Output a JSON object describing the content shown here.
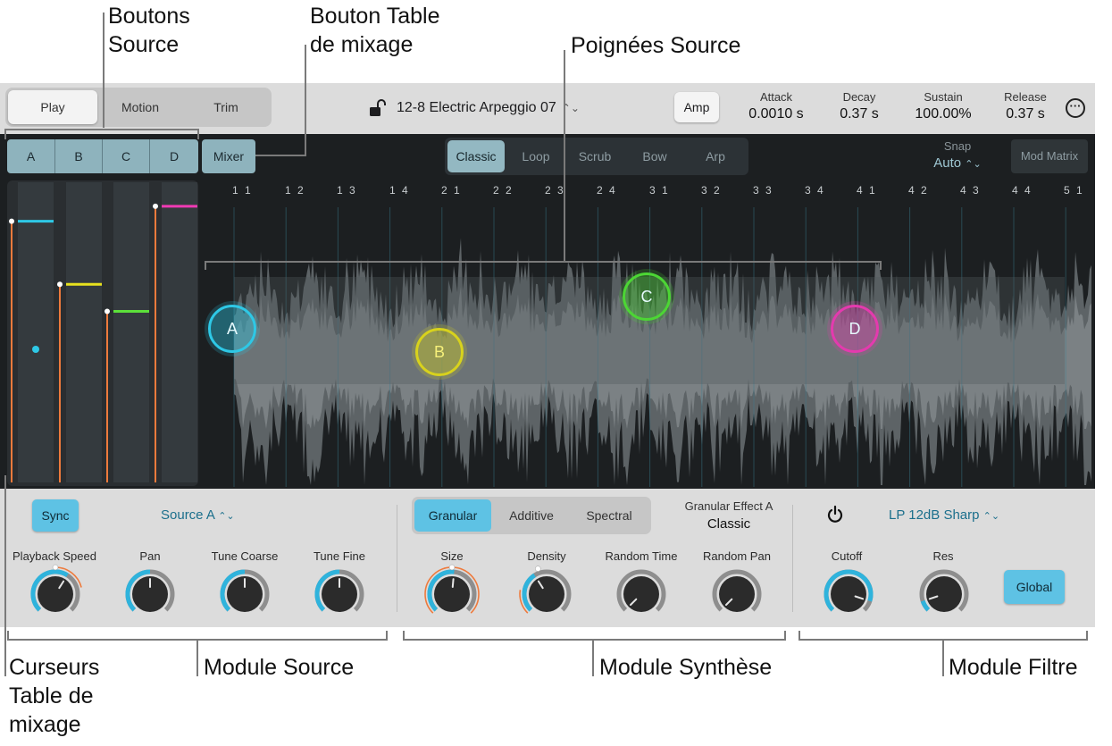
{
  "callouts": {
    "source_buttons": [
      "Boutons",
      "Source"
    ],
    "mixer_button": [
      "Bouton Table",
      "de mixage"
    ],
    "source_handles": "Poignées Source",
    "mixer_faders": [
      "Curseurs",
      "Table de",
      "mixage"
    ],
    "source_module": "Module Source",
    "synthesis_module": "Module Synthèse",
    "filter_module": "Module Filtre"
  },
  "top_bar": {
    "modes": [
      "Play",
      "Motion",
      "Trim"
    ],
    "active_mode": "Play",
    "preset_name": "12-8 Electric Arpeggio 07",
    "amp_label": "Amp",
    "envelope": [
      {
        "label": "Attack",
        "value": "0.0010 s"
      },
      {
        "label": "Decay",
        "value": "0.37 s"
      },
      {
        "label": "Sustain",
        "value": "100.00%"
      },
      {
        "label": "Release",
        "value": "0.37 s"
      }
    ],
    "more_glyph": "···"
  },
  "main": {
    "source_buttons": [
      "A",
      "B",
      "C",
      "D"
    ],
    "mixer_label": "Mixer",
    "play_modes": [
      "Classic",
      "Loop",
      "Scrub",
      "Bow",
      "Arp"
    ],
    "active_play_mode": "Classic",
    "snap_label": "Snap",
    "snap_value": "Auto",
    "mod_matrix_label": "Mod Matrix",
    "ruler": [
      "1 1",
      "1 2",
      "1 3",
      "1 4",
      "2 1",
      "2 2",
      "2 3",
      "2 4",
      "3 1",
      "3 2",
      "3 3",
      "3 4",
      "4 1",
      "4 2",
      "4 3",
      "4 4",
      "5 1"
    ],
    "faders": [
      {
        "source": "A",
        "color": "#2ec8e6",
        "level": 0.87
      },
      {
        "source": "B",
        "color": "#e8e21e",
        "level": 0.66
      },
      {
        "source": "C",
        "color": "#5ce03a",
        "level": 0.57
      },
      {
        "source": "D",
        "color": "#f03ab4",
        "level": 0.92
      }
    ],
    "handles": [
      {
        "label": "A",
        "color": "#2ec8e6"
      },
      {
        "label": "B",
        "color": "#d8d21c"
      },
      {
        "label": "C",
        "color": "#4cd634"
      },
      {
        "label": "D",
        "color": "#e43aae"
      }
    ]
  },
  "source_module": {
    "sync_label": "Sync",
    "source_select": "Source A",
    "knobs": [
      "Playback Speed",
      "Pan",
      "Tune Coarse",
      "Tune Fine"
    ]
  },
  "synth_module": {
    "tabs": [
      "Granular",
      "Additive",
      "Spectral"
    ],
    "active_tab": "Granular",
    "effect_label": "Granular Effect A",
    "effect_value": "Classic",
    "knobs": [
      "Size",
      "Density",
      "Random Time",
      "Random Pan"
    ]
  },
  "filter_module": {
    "filter_type": "LP 12dB Sharp",
    "knobs": [
      "Cutoff",
      "Res"
    ],
    "global_label": "Global"
  }
}
